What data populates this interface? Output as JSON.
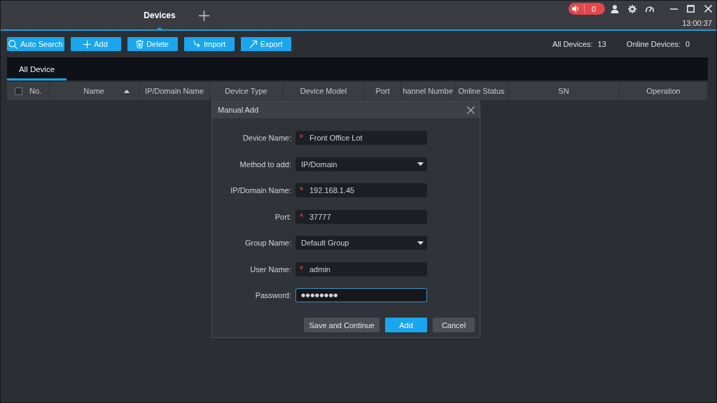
{
  "window": {
    "tabs": [
      {
        "label": "Devices",
        "selected": true
      }
    ],
    "alarm": {
      "count": "0"
    },
    "time": "13:00:37"
  },
  "toolbar": {
    "buttons": [
      {
        "kind": "search",
        "label": "Auto Search"
      },
      {
        "kind": "add",
        "label": "Add"
      },
      {
        "kind": "delete",
        "label": "Delete"
      },
      {
        "kind": "import",
        "label": "Import"
      },
      {
        "kind": "export",
        "label": "Export"
      }
    ],
    "counts": [
      {
        "label": "All Devices:",
        "value": "13"
      },
      {
        "label": "Online Devices:",
        "value": "0"
      }
    ]
  },
  "device_tabs": [
    {
      "label": "All Device",
      "selected": true
    }
  ],
  "table": {
    "select_all": {
      "checked": false
    },
    "columns": [
      {
        "label": "No.",
        "sorted": false
      },
      {
        "label": "Name",
        "sorted": true
      },
      {
        "label": "IP/Domain Name",
        "sorted": false
      },
      {
        "label": "Device Type",
        "sorted": false
      },
      {
        "label": "Device Model",
        "sorted": false
      },
      {
        "label": "Port",
        "sorted": false
      },
      {
        "label": "hannel Numbe",
        "sorted": false
      },
      {
        "label": "Online Status",
        "sorted": false
      },
      {
        "label": "SN",
        "sorted": false
      },
      {
        "label": "Operation",
        "sorted": false
      }
    ]
  },
  "dialog": {
    "title": "Manual Add",
    "fields": [
      {
        "kind": "text",
        "label": "Device Name:",
        "value": "Front Office Lot",
        "required": true,
        "focused": false
      },
      {
        "kind": "dropdown",
        "label": "Method to add:",
        "value": "IP/Domain",
        "required": false,
        "focused": false
      },
      {
        "kind": "text",
        "label": "IP/Domain Name:",
        "value": "192.168.1.45",
        "required": true,
        "focused": false
      },
      {
        "kind": "text",
        "label": "Port:",
        "value": "37777",
        "required": true,
        "focused": false
      },
      {
        "kind": "dropdown",
        "label": "Group Name:",
        "value": "Default Group",
        "required": false,
        "focused": false
      },
      {
        "kind": "text",
        "label": "User Name:",
        "value": "admin",
        "required": true,
        "focused": false
      },
      {
        "kind": "password",
        "label": "Password:",
        "value": "●●●●●●●●",
        "required": false,
        "focused": true
      }
    ],
    "buttons": [
      {
        "label": "Save and Continue",
        "primary": false
      },
      {
        "label": "Add",
        "primary": true
      },
      {
        "label": "Cancel",
        "primary": false
      }
    ]
  }
}
